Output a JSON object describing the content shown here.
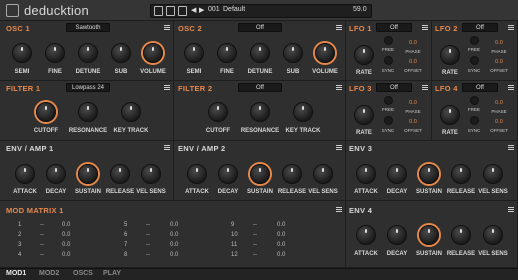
{
  "app": {
    "title": "deducktion"
  },
  "preset": {
    "number": "001",
    "name": "Default",
    "value": "59.0"
  },
  "osc1": {
    "title": "OSC 1",
    "wave": "Sawtooth",
    "knobs": [
      "SEMI",
      "FINE",
      "DETUNE",
      "SUB",
      "VOLUME"
    ]
  },
  "osc2": {
    "title": "OSC 2",
    "wave": "Off",
    "knobs": [
      "SEMI",
      "FINE",
      "DETUNE",
      "SUB",
      "VOLUME"
    ]
  },
  "filter1": {
    "title": "FILTER 1",
    "type": "Lowpass 24",
    "knobs": [
      "CUTOFF",
      "RESONANCE",
      "KEY TRACK"
    ]
  },
  "filter2": {
    "title": "FILTER 2",
    "type": "Off",
    "knobs": [
      "CUTOFF",
      "RESONANCE",
      "KEY TRACK"
    ]
  },
  "lfo": [
    {
      "title": "LFO 1",
      "wave": "Off"
    },
    {
      "title": "LFO 2",
      "wave": "Off"
    },
    {
      "title": "LFO 3",
      "wave": "Off"
    },
    {
      "title": "LFO 4",
      "wave": "Off"
    }
  ],
  "lfo_labels": {
    "rate": "RATE",
    "free": "FREE",
    "sync": "SYNC",
    "phase": "PHASE",
    "offset": "OFFSET",
    "value": "0.0"
  },
  "env_amp1": {
    "title": "ENV / AMP 1"
  },
  "env_amp2": {
    "title": "ENV / AMP 2"
  },
  "env3": {
    "title": "ENV 3"
  },
  "env4": {
    "title": "ENV 4"
  },
  "env_knobs": [
    "ATTACK",
    "DECAY",
    "SUSTAIN",
    "RELEASE",
    "VEL SENS"
  ],
  "modmatrix": {
    "title": "MOD MATRIX 1",
    "rows": [
      [
        "1",
        "--",
        "0.0",
        "5",
        "--",
        "0.0",
        "9",
        "--",
        "0.0"
      ],
      [
        "2",
        "--",
        "0.0",
        "6",
        "--",
        "0.0",
        "10",
        "--",
        "0.0"
      ],
      [
        "3",
        "--",
        "0.0",
        "7",
        "--",
        "0.0",
        "11",
        "--",
        "0.0"
      ],
      [
        "4",
        "--",
        "0.0",
        "8",
        "--",
        "0.0",
        "12",
        "--",
        "0.0"
      ]
    ]
  },
  "tabs": [
    "MOD1",
    "MOD2",
    "OSCS",
    "PLAY"
  ],
  "colors": {
    "accent": "#e8894c",
    "background": "#2b2b2b"
  }
}
